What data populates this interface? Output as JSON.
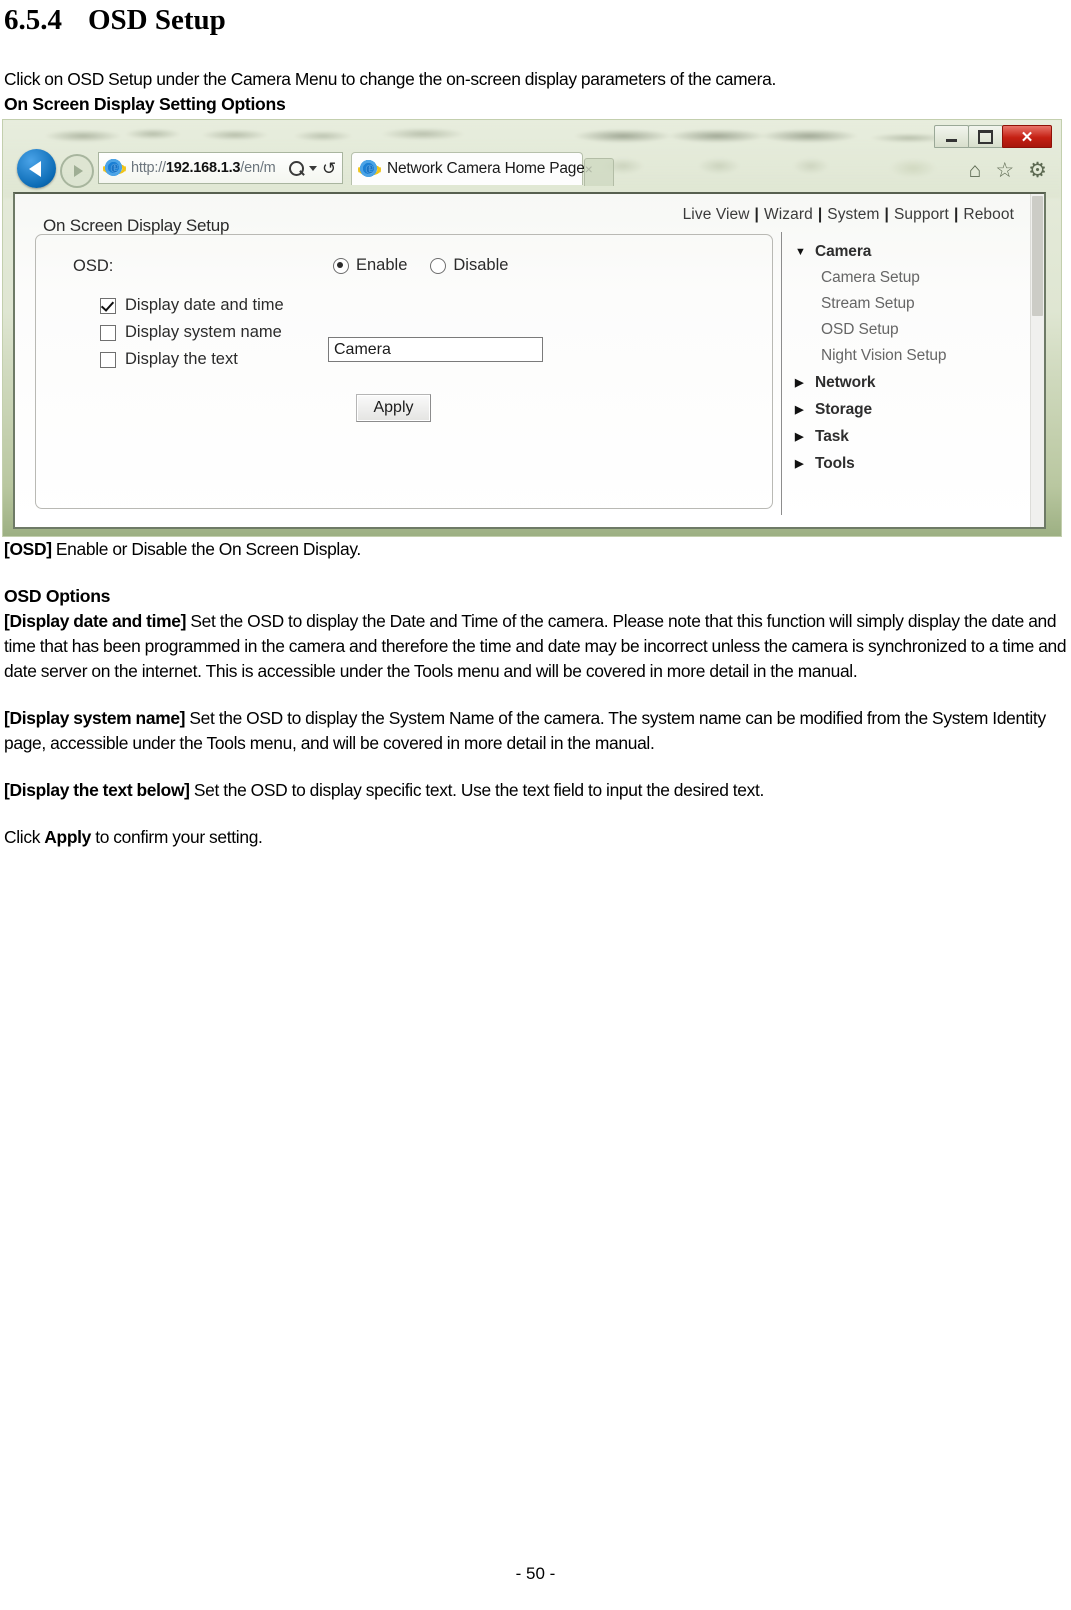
{
  "document": {
    "section_number": "6.5.4",
    "section_title": "OSD Setup",
    "intro": "Click on OSD Setup under the Camera Menu to change the on-screen display parameters of the camera.",
    "figure_caption": "On Screen Display Setting Options",
    "osd_term": "[OSD]",
    "osd_desc": " Enable or Disable the On Screen Display.",
    "options_heading": "OSD Options",
    "option_1_term": "[Display date and time]",
    "option_1_desc": " Set the OSD to display the Date and Time of the camera. Please note that this function will simply display the date and time that has been programmed in the camera and therefore the time and date may be incorrect unless the camera is synchronized to a time and date server on the internet. This is accessible under the Tools menu and will be covered in more detail in the manual.",
    "option_2_term": "[Display system name]",
    "option_2_desc": " Set the OSD to display the System Name of the camera. The system name can be modified from the System Identity page, accessible under the Tools menu, and will be covered in more detail in the manual.",
    "option_3_term": "[Display the text below]",
    "option_3_desc": " Set the OSD to display specific text. Use the text field to input the desired text.",
    "closing_pre": "Click ",
    "closing_bold": "Apply",
    "closing_post": " to confirm your setting.",
    "page_number": "- 50 -"
  },
  "browser": {
    "address_scheme": "http://",
    "address_host": "192.168.1.3",
    "address_path": "/en/m",
    "tab_title": "Network Camera Home Page",
    "tab_close": "×",
    "window_controls": {
      "minimize": "",
      "maximize": "",
      "close": "✕"
    },
    "command_icons": {
      "home": "⌂",
      "favorites": "☆",
      "settings": "⚙"
    },
    "icon_names": {
      "back": "back-arrow-icon",
      "forward": "forward-arrow-icon",
      "search": "search-magnifier-icon",
      "dropdown": "chevron-down-icon",
      "refresh": "refresh-icon"
    }
  },
  "webpage": {
    "topnav": [
      {
        "label": "Live View"
      },
      {
        "label": "Wizard"
      },
      {
        "label": "System"
      },
      {
        "label": "Support"
      },
      {
        "label": "Reboot"
      }
    ],
    "topnav_separator": "|",
    "panel": {
      "title": "On Screen Display Setup",
      "osd_label": "OSD:",
      "radios": [
        {
          "label": "Enable",
          "checked": true
        },
        {
          "label": "Disable",
          "checked": false
        }
      ],
      "checkboxes": [
        {
          "label": "Display date and time",
          "checked": true
        },
        {
          "label": "Display system name",
          "checked": false
        },
        {
          "label": "Display the text",
          "checked": false
        }
      ],
      "text_field_value": "Camera",
      "apply_label": "Apply"
    },
    "sidebar": [
      {
        "label": "Camera",
        "type": "group",
        "arrow": "▼",
        "expanded": true
      },
      {
        "label": "Camera Setup",
        "type": "child"
      },
      {
        "label": "Stream Setup",
        "type": "child"
      },
      {
        "label": "OSD Setup",
        "type": "child"
      },
      {
        "label": "Night Vision Setup",
        "type": "child"
      },
      {
        "label": "Network",
        "type": "group",
        "arrow": "▶",
        "expanded": false
      },
      {
        "label": "Storage",
        "type": "group",
        "arrow": "▶",
        "expanded": false
      },
      {
        "label": "Task",
        "type": "group",
        "arrow": "▶",
        "expanded": false
      },
      {
        "label": "Tools",
        "type": "group",
        "arrow": "▶",
        "expanded": false
      }
    ]
  },
  "colors": {
    "title_bar": "#d6dfc6",
    "close_button": "#c52013",
    "ie_blue": "#1772c4",
    "back_button": "#0b6bb5"
  }
}
